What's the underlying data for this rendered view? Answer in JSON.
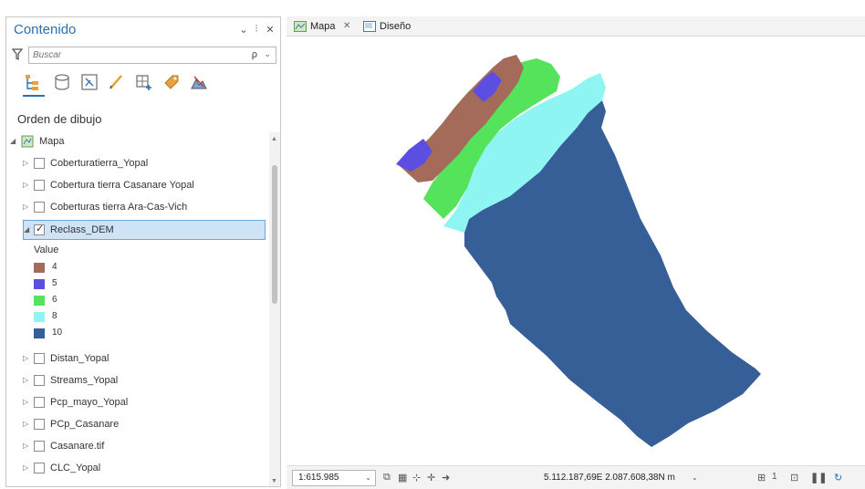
{
  "contents": {
    "title": "Contenido",
    "header_buttons": {
      "menu": "⌄",
      "pin": "⫶",
      "close": "✕"
    },
    "search": {
      "placeholder": "Buscar",
      "search_icon": "ρ",
      "dropdown": "⌄"
    },
    "draw_order_label": "Orden de dibujo",
    "map_item": {
      "label": "Mapa"
    },
    "layers_before": [
      {
        "label": "Coberturatierra_Yopal",
        "checked": false
      },
      {
        "label": "Cobertura tierra Casanare Yopal",
        "checked": false
      },
      {
        "label": "Coberturas tierra Ara-Cas-Vich",
        "checked": false
      }
    ],
    "selected_layer": {
      "label": "Reclass_DEM",
      "checked": true
    },
    "legend": {
      "heading": "Value",
      "items": [
        {
          "label": "4",
          "color": "#a46a5a"
        },
        {
          "label": "5",
          "color": "#5b4ee0"
        },
        {
          "label": "6",
          "color": "#55e35c"
        },
        {
          "label": "8",
          "color": "#8ff5f2"
        },
        {
          "label": "10",
          "color": "#355f96"
        }
      ]
    },
    "layers_after": [
      {
        "label": "Distan_Yopal",
        "checked": false
      },
      {
        "label": "Streams_Yopal",
        "checked": false
      },
      {
        "label": "Pcp_mayo_Yopal",
        "checked": false
      },
      {
        "label": "PCp_Casanare",
        "checked": false
      },
      {
        "label": "Casanare.tif",
        "checked": false
      },
      {
        "label": "CLC_Yopal",
        "checked": false
      }
    ]
  },
  "tabs": [
    {
      "label": "Mapa",
      "closable": true,
      "close_glyph": "✕"
    },
    {
      "label": "Diseño",
      "closable": false
    }
  ],
  "statusbar": {
    "scale": "1:615.985",
    "scale_drop": "⌄",
    "coordinates": "5.112.187,69E 2.087.608,38N m",
    "coords_drop": "⌄",
    "selected_count": "1"
  },
  "colors": {
    "accent": "#2a6fb3",
    "class_4": "#a46a5a",
    "class_5": "#5b4ee0",
    "class_6": "#55e35c",
    "class_8": "#8ff5f2",
    "class_10": "#355f96"
  }
}
